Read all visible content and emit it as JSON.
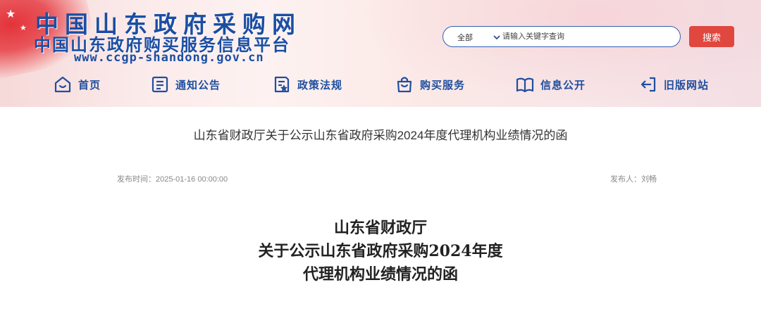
{
  "header": {
    "logo_cn_title": "中国山东政府采购网",
    "logo_platform": "中国山东政府购买服务信息平台",
    "logo_url": "www.ccgp-shandong.gov.cn"
  },
  "search": {
    "scope_selected": "全部",
    "placeholder": "请输入关键字查询",
    "button_label": "搜索"
  },
  "nav": {
    "items": [
      {
        "label": "首页",
        "icon": "home-icon"
      },
      {
        "label": "通知公告",
        "icon": "notice-icon"
      },
      {
        "label": "政策法规",
        "icon": "policy-icon"
      },
      {
        "label": "购买服务",
        "icon": "shopping-bag-icon"
      },
      {
        "label": "信息公开",
        "icon": "book-icon"
      },
      {
        "label": "旧版网站",
        "icon": "exit-icon"
      }
    ]
  },
  "article": {
    "title": "山东省财政厅关于公示山东省政府采购2024年度代理机构业绩情况的函",
    "publish_time": "发布时间：2025-01-16 00:00:00",
    "publisher": "发布人：刘畅",
    "heading_lines": [
      "山东省财政厅",
      "关于公示山东省政府采购2024年度",
      "代理机构业绩情况的函"
    ]
  },
  "colors": {
    "brand_blue": "#1b4ea3",
    "nav_blue": "#1f4f9f",
    "search_button": "#e0473e",
    "header_bg": "#fbeaea"
  }
}
